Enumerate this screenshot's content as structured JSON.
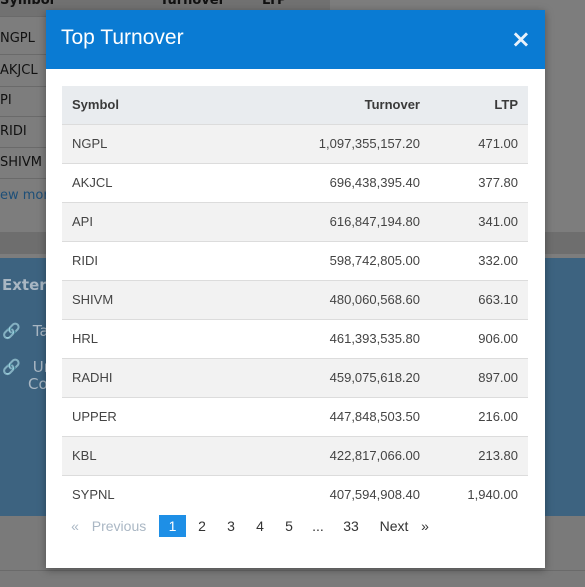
{
  "background": {
    "table_headers": [
      "Symbol",
      "Turnover",
      "LTP"
    ],
    "symbols": [
      "NGPL",
      "AKJCL",
      "PI",
      "RIDI",
      "SHIVM"
    ],
    "view_more": "ew more",
    "section_title": "Exter",
    "links": [
      "Ta",
      "Un",
      "Co"
    ]
  },
  "modal": {
    "title": "Top Turnover",
    "close_symbol": "×",
    "columns": [
      "Symbol",
      "Turnover",
      "LTP"
    ],
    "rows": [
      {
        "symbol": "NGPL",
        "turnover": "1,097,355,157.20",
        "ltp": "471.00"
      },
      {
        "symbol": "AKJCL",
        "turnover": "696,438,395.40",
        "ltp": "377.80"
      },
      {
        "symbol": "API",
        "turnover": "616,847,194.80",
        "ltp": "341.00"
      },
      {
        "symbol": "RIDI",
        "turnover": "598,742,805.00",
        "ltp": "332.00"
      },
      {
        "symbol": "SHIVM",
        "turnover": "480,060,568.60",
        "ltp": "663.10"
      },
      {
        "symbol": "HRL",
        "turnover": "461,393,535.80",
        "ltp": "906.00"
      },
      {
        "symbol": "RADHI",
        "turnover": "459,075,618.20",
        "ltp": "897.00"
      },
      {
        "symbol": "UPPER",
        "turnover": "447,848,503.50",
        "ltp": "216.00"
      },
      {
        "symbol": "KBL",
        "turnover": "422,817,066.00",
        "ltp": "213.80"
      },
      {
        "symbol": "SYPNL",
        "turnover": "407,594,908.40",
        "ltp": "1,940.00"
      }
    ],
    "pagination": {
      "prev_arrow": "«",
      "prev_label": "Previous",
      "pages": [
        "1",
        "2",
        "3",
        "4",
        "5",
        "...",
        "33"
      ],
      "active_page": "1",
      "next_label": "Next",
      "next_arrow": "»"
    }
  },
  "colors": {
    "header_blue": "#0a7bd3",
    "active_page": "#1e8fe6",
    "overlay_gray": "#7d7d7d"
  }
}
